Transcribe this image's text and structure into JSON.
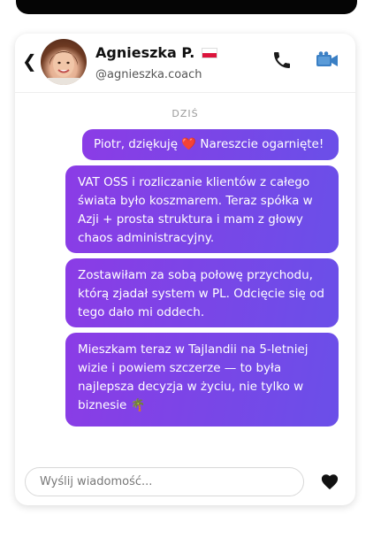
{
  "contact": {
    "name": "Agnieszka P.",
    "handle": "@agnieszka.coach"
  },
  "icons": {
    "back": "chevron-left-icon",
    "flag": "poland-flag-icon",
    "call": "phone-icon",
    "video": "video-camera-icon",
    "like": "heart-icon"
  },
  "chat": {
    "day_label": "DZIŚ",
    "messages": [
      "Piotr, dziękuję ❤️ Nareszcie ogarnięte!",
      "VAT OSS i rozliczanie klientów z całego świata było koszmarem. Teraz spółka w Azji + prosta struktura i mam z głowy chaos administracyjny.",
      "Zostawiłam za sobą połowę przychodu, którą zjadał system w PL. Odcięcie się od tego dało mi oddech.",
      "Mieszkam teraz w Tajlandii na 5-letniej wizie i powiem szczerze — to była najlepsza decyzja w życiu, nie tylko w biznesie 🌴"
    ]
  },
  "composer": {
    "placeholder": "Wyślij wiadomość..."
  },
  "colors": {
    "bubble_start": "#8b3ce6",
    "bubble_end": "#6a4fe8",
    "top_bar": "#050505"
  }
}
